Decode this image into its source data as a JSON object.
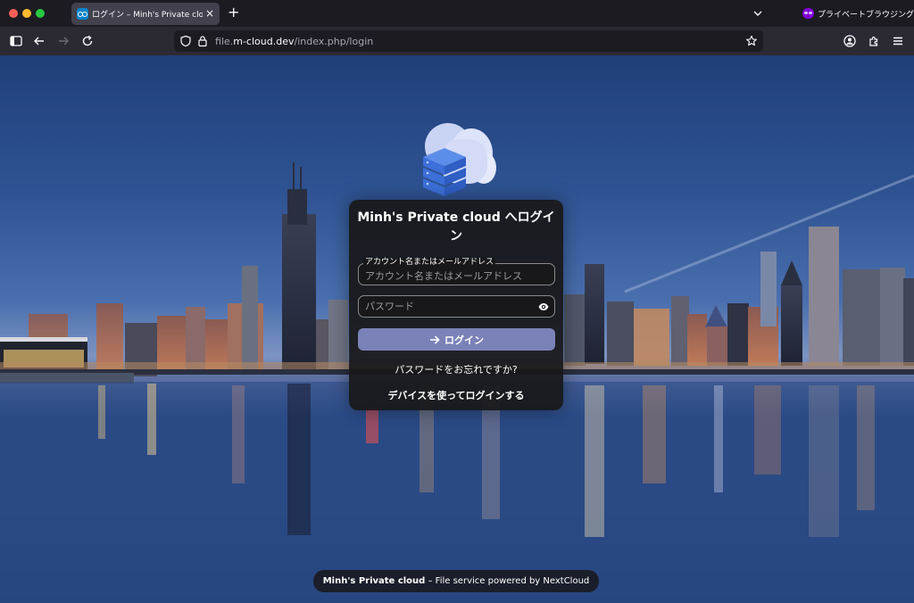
{
  "browser": {
    "tab_title": "ログイン – Minh's Private cloud",
    "tab_close": "×",
    "new_tab": "+",
    "private_label": "プライベートブラウジング",
    "url_prefix": "file.",
    "url_domain": "m-cloud.dev",
    "url_path": "/index.php/login"
  },
  "login": {
    "title": "Minh's Private cloud へログイン",
    "username_label": "アカウント名またはメールアドレス",
    "username_placeholder": "アカウント名またはメールアドレス",
    "password_placeholder": "パスワード",
    "button_label": "ログイン",
    "forgot_label": "パスワードをお忘れですか?",
    "device_label": "デバイスを使ってログインする"
  },
  "footer": {
    "brand": "Minh's Private cloud",
    "tagline": " – File service powered by NextCloud"
  },
  "colors": {
    "accent": "#7b82b8",
    "favicon": "#0082c9",
    "private": "#8000d7"
  },
  "icons": [
    "sidebar-icon",
    "back-icon",
    "forward-icon",
    "reload-icon",
    "shield-icon",
    "lock-icon",
    "star-icon",
    "account-icon",
    "extensions-icon",
    "menu-icon",
    "eye-icon",
    "arrow-right-icon"
  ]
}
